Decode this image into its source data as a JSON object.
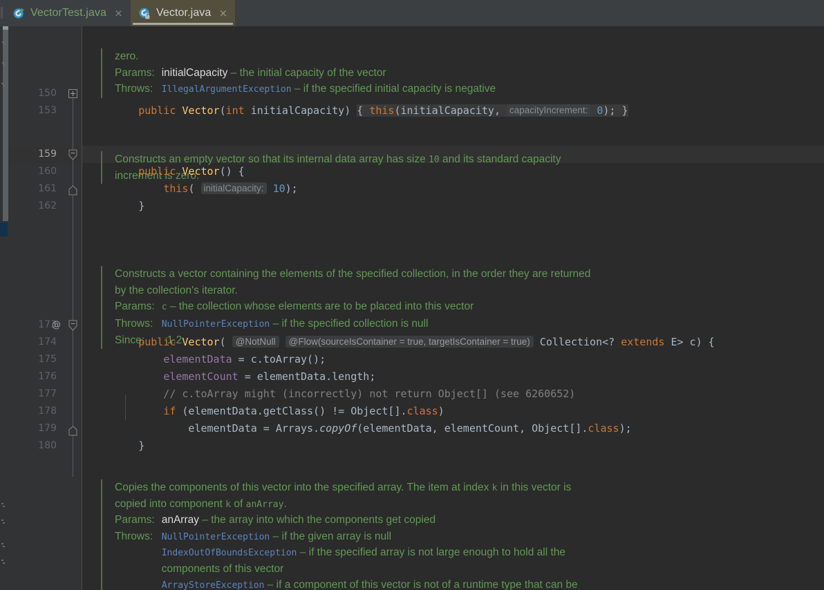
{
  "window": {
    "theme_bg": "#2b2b2b",
    "gutter_bg": "#313335",
    "tabbar_bg": "#3c3f41",
    "active_tab_bg": "#534f3c",
    "javadoc_color": "#629755"
  },
  "tabs": [
    {
      "label": "VectorTest.java",
      "icon": "java-test-class-icon",
      "close": "×",
      "active": false
    },
    {
      "label": "Vector.java",
      "icon": "java-class-readonly-icon",
      "close": "×",
      "active": true
    }
  ],
  "editor": {
    "file": "Vector.java",
    "gutter": {
      "lines": [
        "150",
        "153",
        "159",
        "160",
        "161",
        "162",
        "173",
        "174",
        "175",
        "176",
        "177",
        "178",
        "179",
        "180"
      ],
      "current_line": "159",
      "annotation_at_173": "@"
    },
    "docblocks": [
      {
        "id": "doc-initial-capacity",
        "lines": [
          {
            "type": "text",
            "runs": [
              {
                "t": "zero.",
                "s": "n"
              }
            ]
          }
        ],
        "tags": [
          {
            "tag": "Params:",
            "rows": [
              {
                "runs": [
                  {
                    "t": "initialCapacity",
                    "s": "p"
                  },
                  {
                    "t": " – the initial capacity of the vector",
                    "s": "n"
                  }
                ]
              }
            ]
          },
          {
            "tag": "Throws:",
            "rows": [
              {
                "runs": [
                  {
                    "t": "IllegalArgumentException",
                    "s": "l"
                  },
                  {
                    "t": " – if the specified initial capacity is negative",
                    "s": "n"
                  }
                ]
              }
            ]
          }
        ]
      },
      {
        "id": "doc-empty-vector",
        "lines": [
          {
            "type": "text",
            "runs": [
              {
                "t": "Constructs an empty vector so that its internal data array has size ",
                "s": "n"
              },
              {
                "t": "10",
                "s": "m"
              },
              {
                "t": " and its standard capacity",
                "s": "n"
              }
            ]
          },
          {
            "type": "text",
            "runs": [
              {
                "t": "increment is zero.",
                "s": "n"
              }
            ]
          }
        ],
        "tags": []
      },
      {
        "id": "doc-collection-vector",
        "lines": [
          {
            "type": "text",
            "runs": [
              {
                "t": "Constructs a vector containing the elements of the specified collection, in the order they are returned",
                "s": "n"
              }
            ]
          },
          {
            "type": "text",
            "runs": [
              {
                "t": "by the collection's iterator.",
                "s": "n"
              }
            ]
          }
        ],
        "tags": [
          {
            "tag": "Params:",
            "rows": [
              {
                "runs": [
                  {
                    "t": "c",
                    "s": "m"
                  },
                  {
                    "t": " – the collection whose elements are to be placed into this vector",
                    "s": "n"
                  }
                ]
              }
            ]
          },
          {
            "tag": "Throws:",
            "rows": [
              {
                "runs": [
                  {
                    "t": "NullPointerException",
                    "s": "l"
                  },
                  {
                    "t": " – if the specified collection is null",
                    "s": "n"
                  }
                ]
              }
            ]
          },
          {
            "tag": "Since:",
            "rows": [
              {
                "runs": [
                  {
                    "t": "1.2",
                    "s": "n"
                  }
                ]
              }
            ]
          }
        ]
      },
      {
        "id": "doc-copy-into",
        "lines": [
          {
            "type": "text",
            "runs": [
              {
                "t": "Copies the components of this vector into the specified array. The item at index ",
                "s": "n"
              },
              {
                "t": "k",
                "s": "m"
              },
              {
                "t": " in this vector is",
                "s": "n"
              }
            ]
          },
          {
            "type": "text",
            "runs": [
              {
                "t": "copied into component ",
                "s": "n"
              },
              {
                "t": "k",
                "s": "m"
              },
              {
                "t": " of ",
                "s": "n"
              },
              {
                "t": "anArray",
                "s": "m"
              },
              {
                "t": ".",
                "s": "n"
              }
            ]
          }
        ],
        "tags": [
          {
            "tag": "Params:",
            "rows": [
              {
                "runs": [
                  {
                    "t": "anArray",
                    "s": "p"
                  },
                  {
                    "t": " – the array into which the components get copied",
                    "s": "n"
                  }
                ]
              }
            ]
          },
          {
            "tag": "Throws:",
            "rows": [
              {
                "runs": [
                  {
                    "t": "NullPointerException",
                    "s": "l"
                  },
                  {
                    "t": " – if the given array is null",
                    "s": "n"
                  }
                ]
              },
              {
                "runs": [
                  {
                    "t": "IndexOutOfBoundsException",
                    "s": "l"
                  },
                  {
                    "t": " – if the specified array is not large enough to hold all the",
                    "s": "n"
                  }
                ]
              },
              {
                "runs": [
                  {
                    "t": "components of this vector",
                    "s": "n"
                  }
                ]
              },
              {
                "runs": [
                  {
                    "t": "ArrayStoreException",
                    "s": "l"
                  },
                  {
                    "t": " – if a component of this vector is not of a runtime type that can be",
                    "s": "n"
                  }
                ]
              }
            ]
          }
        ]
      }
    ],
    "code_rows": [
      {
        "line": "150",
        "runs": [
          {
            "t": "public ",
            "s": "kw"
          },
          {
            "t": "Vector",
            "s": "mth"
          },
          {
            "t": "(",
            "s": "plain"
          },
          {
            "t": "int ",
            "s": "kw"
          },
          {
            "t": "initialCapacity",
            "s": "plain"
          },
          {
            "t": ") ",
            "s": "plain"
          },
          {
            "t": "{ ",
            "s": "fold-open"
          },
          {
            "t": "this",
            "s": "kw-fold"
          },
          {
            "t": "(initialCapacity, ",
            "s": "plain-fold"
          },
          {
            "t": "capacityIncrement:",
            "s": "inlay"
          },
          {
            "t": " ",
            "s": "plain-fold"
          },
          {
            "t": "0",
            "s": "num-fold"
          },
          {
            "t": "); ",
            "s": "plain-fold"
          },
          {
            "t": "}",
            "s": "fold-close"
          }
        ]
      },
      {
        "line": "159",
        "runs": [
          {
            "t": "public ",
            "s": "kw"
          },
          {
            "t": "Vector",
            "s": "mth"
          },
          {
            "t": "() {",
            "s": "plain"
          }
        ]
      },
      {
        "line": "160",
        "runs": [
          {
            "t": "    ",
            "s": "plain"
          },
          {
            "t": "this",
            "s": "kw"
          },
          {
            "t": "( ",
            "s": "plain"
          },
          {
            "t": "initialCapacity:",
            "s": "inlay"
          },
          {
            "t": " ",
            "s": "plain"
          },
          {
            "t": "10",
            "s": "num"
          },
          {
            "t": ");",
            "s": "plain"
          }
        ]
      },
      {
        "line": "161",
        "runs": [
          {
            "t": "}",
            "s": "plain"
          }
        ]
      },
      {
        "line": "173",
        "runs": [
          {
            "t": "public ",
            "s": "kw"
          },
          {
            "t": "Vector",
            "s": "mth"
          },
          {
            "t": "( ",
            "s": "plain"
          },
          {
            "t": "@NotNull",
            "s": "annot"
          },
          {
            "t": " ",
            "s": "plain"
          },
          {
            "t": "@Flow(sourceIsContainer = true, targetIsContainer = true)",
            "s": "annot"
          },
          {
            "t": " ",
            "s": "plain"
          },
          {
            "t": "Collection",
            "s": "plain"
          },
          {
            "t": "<? ",
            "s": "plain"
          },
          {
            "t": "extends ",
            "s": "kw"
          },
          {
            "t": "E> c) {",
            "s": "plain"
          }
        ]
      },
      {
        "line": "174",
        "runs": [
          {
            "t": "    ",
            "s": "plain"
          },
          {
            "t": "elementData",
            "s": "fld"
          },
          {
            "t": " = c.toArray();",
            "s": "plain"
          }
        ]
      },
      {
        "line": "175",
        "runs": [
          {
            "t": "    ",
            "s": "plain"
          },
          {
            "t": "elementCount",
            "s": "fld"
          },
          {
            "t": " = elementData.length;",
            "s": "plain"
          }
        ]
      },
      {
        "line": "176",
        "runs": [
          {
            "t": "    // c.toArray might (incorrectly) not return Object[] (see 6260652)",
            "s": "cmt"
          }
        ]
      },
      {
        "line": "177",
        "runs": [
          {
            "t": "    ",
            "s": "plain"
          },
          {
            "t": "if ",
            "s": "kw"
          },
          {
            "t": "(elementData.getClass() != Object[].",
            "s": "plain"
          },
          {
            "t": "class",
            "s": "kw"
          },
          {
            "t": ")",
            "s": "plain"
          }
        ]
      },
      {
        "line": "178",
        "runs": [
          {
            "t": "        elementData = Arrays.",
            "s": "plain"
          },
          {
            "t": "copyOf",
            "s": "stat"
          },
          {
            "t": "(elementData, elementCount, Object[].",
            "s": "plain"
          },
          {
            "t": "class",
            "s": "kw"
          },
          {
            "t": ");",
            "s": "plain"
          }
        ]
      },
      {
        "line": "179",
        "runs": [
          {
            "t": "}",
            "s": "plain"
          }
        ]
      }
    ]
  }
}
